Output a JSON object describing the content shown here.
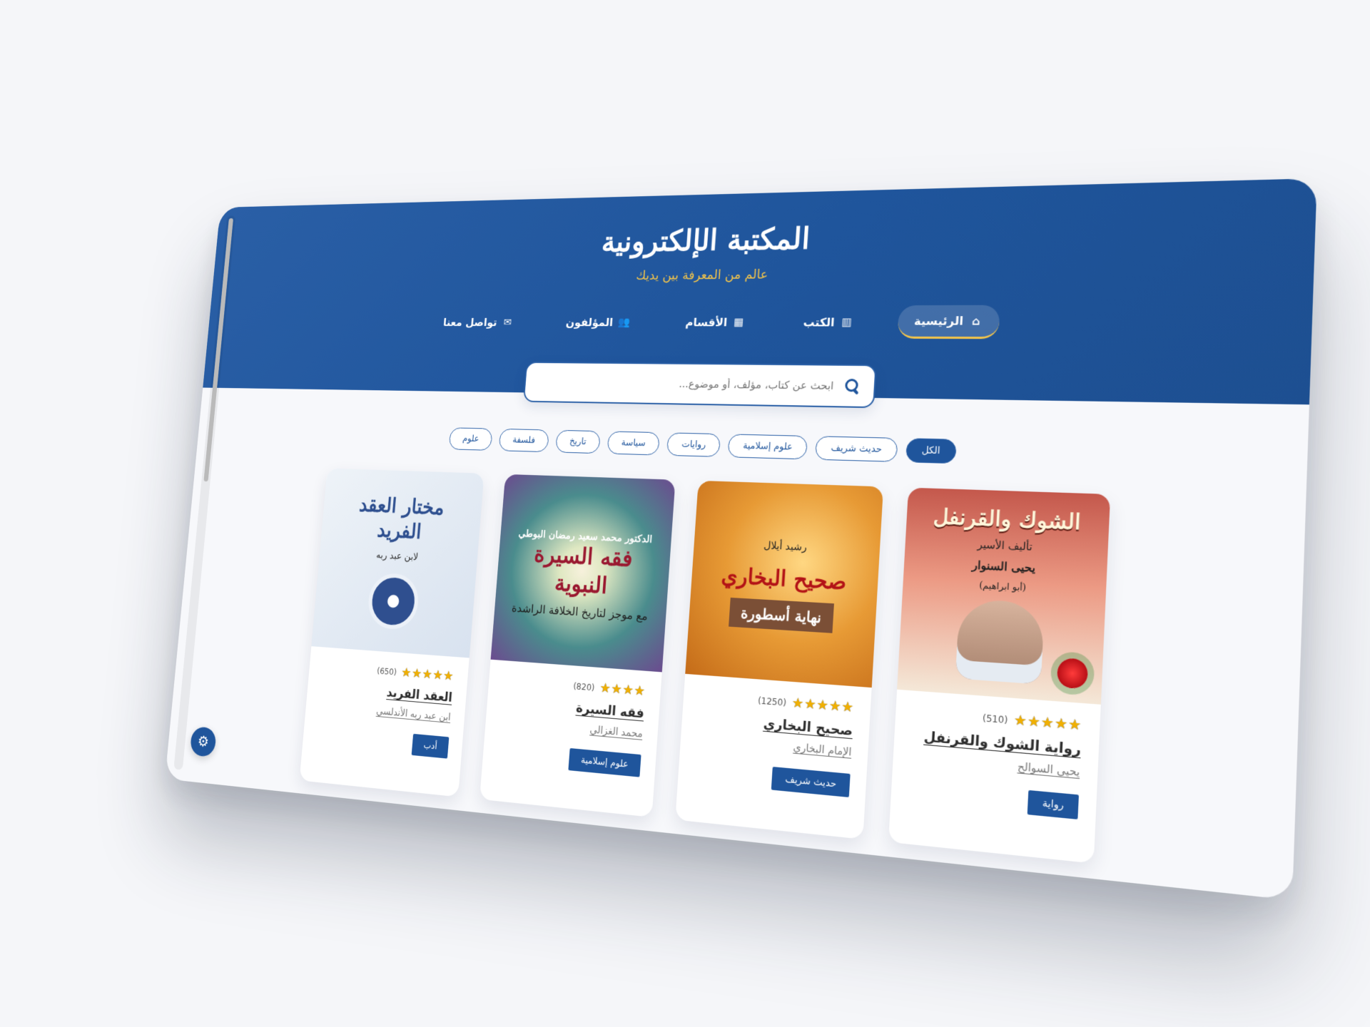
{
  "site": {
    "title": "المكتبة الإلكترونية",
    "subtitle": "عالم من المعرفة بين يديك"
  },
  "nav": [
    {
      "label": "الرئيسية",
      "icon": "home-icon",
      "active": true
    },
    {
      "label": "الكتب",
      "icon": "book-icon",
      "active": false
    },
    {
      "label": "الأقسام",
      "icon": "grid-icon",
      "active": false
    },
    {
      "label": "المؤلفون",
      "icon": "users-icon",
      "active": false
    },
    {
      "label": "تواصل معنا",
      "icon": "mail-icon",
      "active": false
    }
  ],
  "search": {
    "placeholder": "ابحث عن كتاب، مؤلف، أو موضوع...",
    "value": ""
  },
  "filters": [
    {
      "label": "الكل",
      "active": true
    },
    {
      "label": "حديث شريف",
      "active": false
    },
    {
      "label": "علوم إسلامية",
      "active": false
    },
    {
      "label": "روايات",
      "active": false
    },
    {
      "label": "سياسة",
      "active": false
    },
    {
      "label": "تاريخ",
      "active": false
    },
    {
      "label": "فلسفة",
      "active": false
    },
    {
      "label": "علوم",
      "active": false
    }
  ],
  "books": [
    {
      "cover_line_1": "الشوك والقرنفل",
      "cover_line_2": "يحيى السنوار",
      "cover_line_3": "تأليف الأسير",
      "cover_line_4": "(أبو ابراهيم)",
      "rating": "★★★★★",
      "reviews": "(510)",
      "title": "رواية الشوك والقرنفل",
      "author": "يحيى السوالح",
      "category": "رواية"
    },
    {
      "cover_line_1": "صحيح البخاري",
      "cover_line_2": "نهاية أسطورة",
      "cover_line_3": "رشيد أيلال",
      "rating": "★★★★★",
      "reviews": "(1250)",
      "title": "صحيح البخاري",
      "author": "الإمام البخاري",
      "category": "حديث شريف"
    },
    {
      "cover_line_1": "فقه السيرة النبوية",
      "cover_line_2": "مع موجز لتاريخ الخلافة الراشدة",
      "cover_line_3": "الدكتور محمد سعيد رمضان البوطي",
      "rating": "★★★★",
      "reviews": "(820)",
      "title": "فقه السيرة",
      "author": "محمد الغزالي",
      "category": "علوم إسلامية"
    },
    {
      "cover_line_1": "مختار العقد الفريد",
      "cover_line_2": "لابن عبد ربه",
      "rating": "★★★★★",
      "reviews": "(650)",
      "title": "العقد الفريد",
      "author": "ابن عبد ربه الأندلسي",
      "category": "أدب"
    }
  ],
  "fab": {
    "icon": "gear-icon",
    "label": "⚙"
  }
}
